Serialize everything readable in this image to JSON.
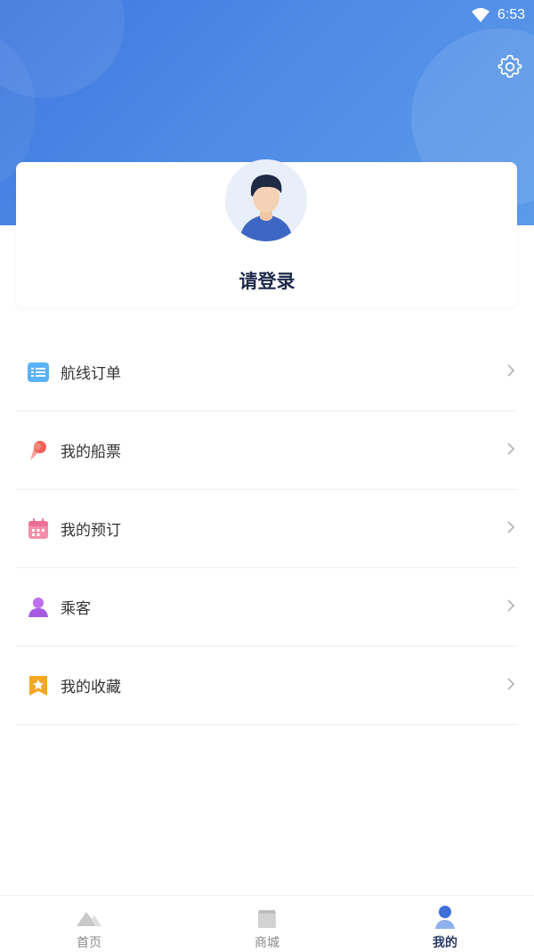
{
  "status_bar": {
    "time": "6:53",
    "wifi_icon": "wifi-icon"
  },
  "header": {
    "settings_icon": "gear-icon",
    "accent_color": "#4a86e4"
  },
  "profile": {
    "login_prompt": "请登录",
    "avatar_icon": "user-avatar-icon"
  },
  "menu": {
    "items": [
      {
        "label": "航线订单",
        "icon": "list-icon",
        "color": "#4aa8f4"
      },
      {
        "label": "我的船票",
        "icon": "ticket-icon",
        "color": "#f2605a"
      },
      {
        "label": "我的预订",
        "icon": "calendar-icon",
        "color": "#f07aa0"
      },
      {
        "label": "乘客",
        "icon": "person-icon",
        "color": "#b76ce8"
      },
      {
        "label": "我的收藏",
        "icon": "star-icon",
        "color": "#f5a623"
      }
    ]
  },
  "tabbar": {
    "tabs": [
      {
        "label": "首页",
        "icon": "home-icon",
        "active": false
      },
      {
        "label": "商城",
        "icon": "shop-icon",
        "active": false
      },
      {
        "label": "我的",
        "icon": "profile-icon",
        "active": true
      }
    ]
  }
}
